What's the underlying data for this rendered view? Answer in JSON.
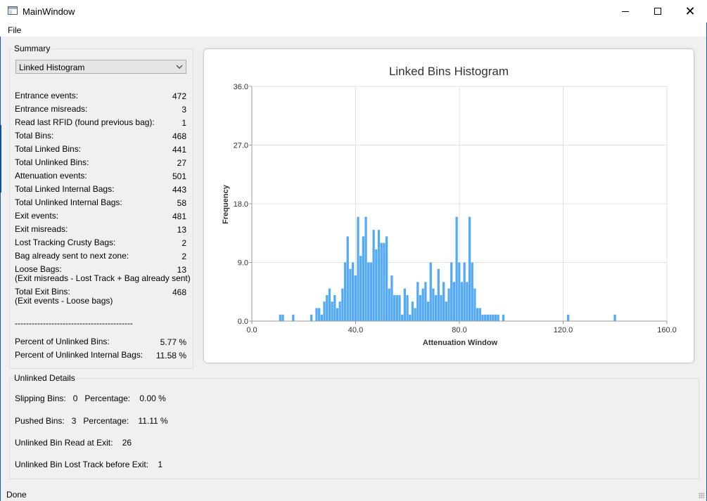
{
  "window": {
    "title": "MainWindow",
    "minimize_icon": "minimize-icon",
    "maximize_icon": "maximize-icon",
    "close_icon": "close-icon",
    "close_glyph": "✕"
  },
  "menu": {
    "file": "File"
  },
  "summary": {
    "title": "Summary",
    "combo_value": "Linked Histogram",
    "stats": [
      {
        "label": "Entrance events:",
        "value": "472"
      },
      {
        "label": "Entrance misreads:",
        "value": "3"
      },
      {
        "label": "Read last RFID (found previous bag):",
        "value": "1"
      },
      {
        "label": "Total Bins:",
        "value": "468"
      },
      {
        "label": "Total Linked Bins:",
        "value": "441"
      },
      {
        "label": "Total Unlinked Bins:",
        "value": "27"
      },
      {
        "label": "Attenuation events:",
        "value": "501"
      },
      {
        "label": "Total Linked Internal Bags:",
        "value": "443"
      },
      {
        "label": "Total Unlinked Internal Bags:",
        "value": "58"
      },
      {
        "label": "Exit events:",
        "value": "481"
      },
      {
        "label": "Exit misreads:",
        "value": "13"
      },
      {
        "label": "Lost Tracking Crusty Bags:",
        "value": "2"
      },
      {
        "label": "Bag already sent to next zone:",
        "value": "2"
      },
      {
        "label": "Loose Bags:\n(Exit misreads - Lost Track + Bag already sent)",
        "value": "13"
      },
      {
        "label": "Total Exit Bins:\n(Exit events - Loose bags)",
        "value": "468"
      }
    ],
    "separator": "------------------------------------------",
    "percents": [
      {
        "label": "Percent of Unlinked Bins:",
        "value": "5.77 %"
      },
      {
        "label": "Percent of Unlinked Internal Bags:",
        "value": "11.58 %"
      }
    ]
  },
  "unlinked": {
    "title": "Unlinked Details",
    "lines": [
      "Slipping Bins:   0   Percentage:    0.00 %",
      "Pushed Bins:   3   Percentage:    11.11 %",
      "Unlinked Bin Read at Exit:    26",
      "Unlinked Bin Lost Track before Exit:    1"
    ]
  },
  "status": {
    "text": "Done"
  },
  "colors": {
    "bar": "#55aaf5",
    "grid": "#e0e0e0"
  },
  "chart_data": {
    "type": "bar",
    "title": "Linked Bins Histogram",
    "xlabel": "Attenuation Window",
    "ylabel": "Frequency",
    "xlim": [
      0,
      160
    ],
    "ylim": [
      0,
      36
    ],
    "x_ticks": [
      "0.0",
      "40.0",
      "80.0",
      "120.0",
      "160.0"
    ],
    "y_ticks": [
      "0.0",
      "9.0",
      "18.0",
      "27.0",
      "36.0"
    ],
    "bin_width": 1,
    "x": [
      11,
      12,
      16,
      23,
      25,
      26,
      27,
      28,
      29,
      30,
      31,
      32,
      33,
      34,
      35,
      36,
      37,
      38,
      39,
      40,
      41,
      42,
      43,
      44,
      45,
      46,
      47,
      48,
      49,
      50,
      51,
      52,
      53,
      54,
      55,
      56,
      57,
      58,
      59,
      60,
      61,
      62,
      63,
      64,
      65,
      66,
      67,
      68,
      69,
      70,
      71,
      72,
      73,
      74,
      75,
      76,
      77,
      78,
      79,
      80,
      81,
      82,
      83,
      84,
      85,
      86,
      87,
      88,
      89,
      90,
      91,
      92,
      93,
      94,
      95,
      97,
      122,
      140
    ],
    "values": [
      1,
      1,
      1,
      1,
      2,
      2,
      1,
      3,
      4,
      5,
      3,
      4,
      2,
      3,
      5,
      9,
      13,
      8,
      9,
      7,
      16,
      10,
      13,
      16,
      9,
      9,
      14,
      11,
      14,
      12,
      12,
      13,
      5,
      7,
      4,
      4,
      4,
      1,
      5,
      4,
      1,
      3,
      2,
      6,
      4,
      5,
      6,
      3,
      9,
      5,
      4,
      8,
      4,
      6,
      3,
      5,
      9,
      6,
      16,
      9,
      6,
      9,
      6,
      16,
      9,
      5,
      2,
      2,
      1,
      1,
      1,
      1,
      1,
      1,
      1,
      1,
      1,
      1
    ]
  }
}
